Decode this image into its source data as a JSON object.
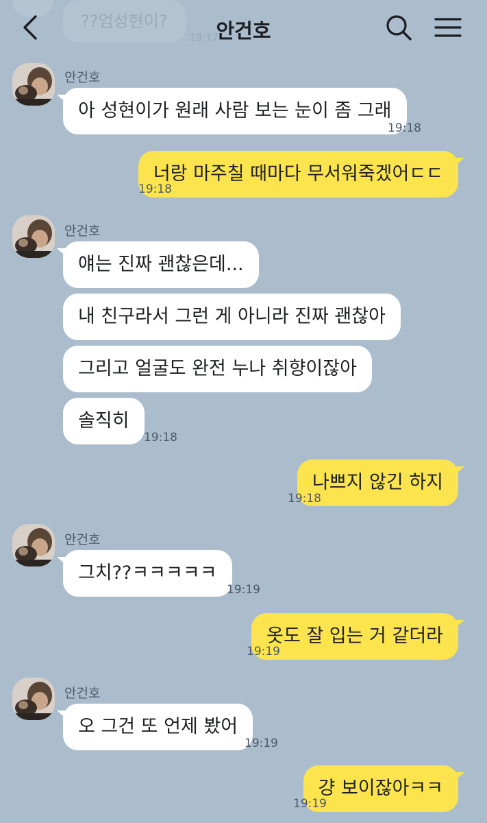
{
  "header": {
    "title": "안건호",
    "prev_message": "??엄성현이?",
    "prev_time": "19:17",
    "back_icon": "chevron-left-icon",
    "search_icon": "search-icon",
    "menu_icon": "hamburger-menu-icon"
  },
  "messages": [
    {
      "sender": "안건호",
      "side": "left",
      "text": "아 성현이가 원래 사람 보는 눈이 좀 그래",
      "time": "19:18"
    },
    {
      "side": "right",
      "text": "너랑 마주칠 때마다 무서워죽겠어ㄷㄷ",
      "time": "19:18"
    },
    {
      "sender": "안건호",
      "side": "left",
      "text": "얘는 진짜 괜찮은데..."
    },
    {
      "side": "left",
      "text": "내 친구라서 그런 게 아니라 진짜 괜찮아"
    },
    {
      "side": "left",
      "text": "그리고 얼굴도 완전 누나 취향이잖아"
    },
    {
      "side": "left",
      "text": "솔직히",
      "time": "19:18"
    },
    {
      "side": "right",
      "text": "나쁘지 않긴 하지",
      "time": "19:18"
    },
    {
      "sender": "안건호",
      "side": "left",
      "text": "그치??ㅋㅋㅋㅋㅋ",
      "time": "19:19"
    },
    {
      "side": "right",
      "text": "옷도 잘 입는 거 같더라",
      "time": "19:19"
    },
    {
      "sender": "안건호",
      "side": "left",
      "text": "오 그건 또 언제 봤어",
      "time": "19:19"
    },
    {
      "side": "right",
      "text": "걍 보이잖아ㅋㅋ",
      "time": "19:19"
    }
  ],
  "colors": {
    "background": "#abbdcd",
    "my_bubble": "#fbe44e",
    "their_bubble": "#ffffff"
  }
}
